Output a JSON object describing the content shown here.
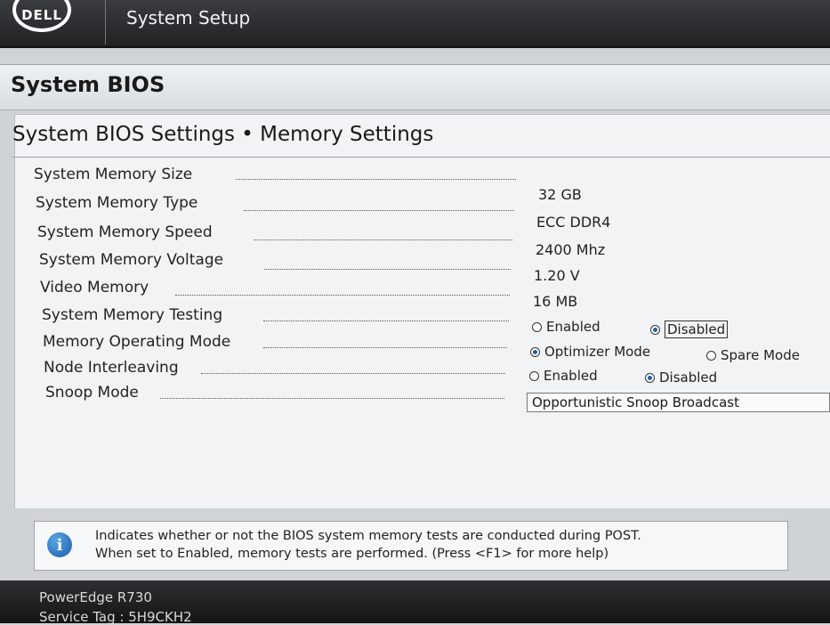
{
  "header": {
    "logo_text": "DELL",
    "app_title": "System Setup"
  },
  "section": {
    "title": "System BIOS"
  },
  "page": {
    "title": "System BIOS Settings • Memory Settings"
  },
  "settings": [
    {
      "label": "System Memory Size",
      "value": "32 GB"
    },
    {
      "label": "System Memory Type",
      "value": "ECC DDR4"
    },
    {
      "label": "System Memory Speed",
      "value": "2400 Mhz"
    },
    {
      "label": "System Memory Voltage",
      "value": "1.20 V"
    },
    {
      "label": "Video Memory",
      "value": "16 MB"
    },
    {
      "label": "System Memory Testing",
      "options": [
        "Enabled",
        "Disabled"
      ],
      "selected": "Disabled"
    },
    {
      "label": "Memory Operating Mode",
      "options": [
        "Optimizer Mode",
        "Spare Mode"
      ],
      "selected": "Optimizer Mode"
    },
    {
      "label": "Node Interleaving",
      "options": [
        "Enabled",
        "Disabled"
      ],
      "selected": "Disabled"
    },
    {
      "label": "Snoop Mode",
      "value": "Opportunistic Snoop Broadcast"
    }
  ],
  "help": {
    "icon": "info-icon",
    "line1": "Indicates whether or not the BIOS system memory tests are conducted during POST.",
    "line2": "When set to Enabled, memory tests are performed. (Press <F1> for more help)"
  },
  "footer": {
    "model": "PowerEdge R730",
    "service_tag": "Service Tag : 5H9CKH2"
  },
  "colors": {
    "topbar": "#202224",
    "radio_selected": "#1f5fa8",
    "panel": "#f1f3f4"
  }
}
